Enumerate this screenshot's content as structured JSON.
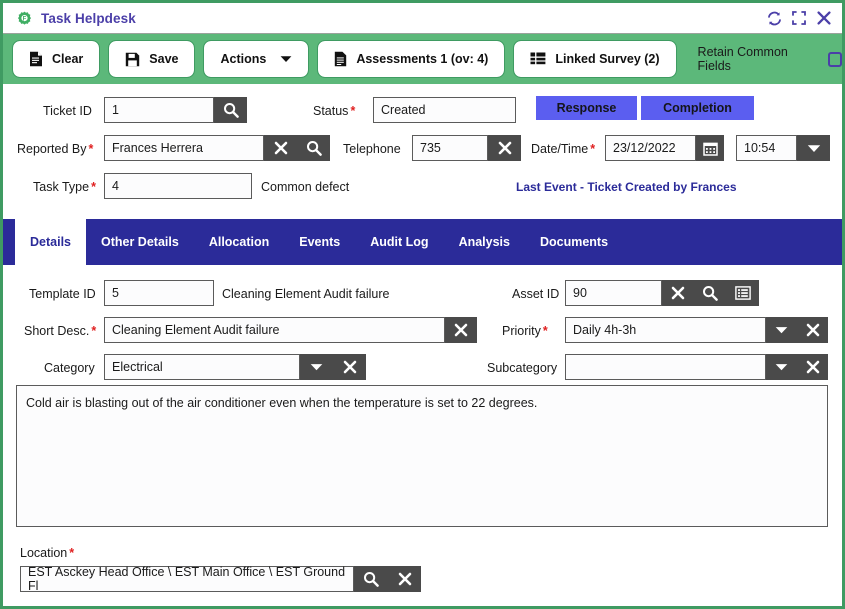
{
  "window": {
    "title": "Task Helpdesk",
    "icon": "gear-icon",
    "controls": [
      {
        "name": "refresh-icon",
        "label": "Refresh"
      },
      {
        "name": "maximize-icon",
        "label": "Maximize"
      },
      {
        "name": "close-icon",
        "label": "Close"
      }
    ],
    "accent_green": "#5cb87a",
    "accent_indigo": "#2b2b99",
    "accent_blue": "#5b5ef0"
  },
  "toolbar": {
    "buttons": [
      {
        "label": "Clear",
        "icon": "document-icon"
      },
      {
        "label": "Save",
        "icon": "floppy-disk-icon"
      },
      {
        "label": "Actions",
        "icon": "",
        "caret": true
      },
      {
        "label": "Assessments 1 (ov: 4)",
        "icon": "document-lines-icon"
      },
      {
        "label": "Linked Survey (2)",
        "icon": "list-grid-icon"
      }
    ],
    "retain_label": "Retain Common Fields",
    "retain_checked": false
  },
  "header": {
    "ticket_id": {
      "label": "Ticket ID",
      "value": "1",
      "required": false
    },
    "status": {
      "label": "Status",
      "value": "Created",
      "required": true
    },
    "reported_by": {
      "label": "Reported By",
      "value": "Frances Herrera",
      "required": true
    },
    "telephone": {
      "label": "Telephone",
      "value": "735",
      "required": false
    },
    "date_time": {
      "label": "Date/Time",
      "date": "23/12/2022",
      "time": "10:54",
      "required": true
    },
    "task_type": {
      "label": "Task Type",
      "value": "4",
      "required": true,
      "hint": "Common defect"
    },
    "response_button": "Response",
    "completion_button": "Completion",
    "last_event": "Last Event -  Ticket Created by Frances"
  },
  "tabs": [
    {
      "label": "Details",
      "active": true
    },
    {
      "label": "Other Details",
      "active": false
    },
    {
      "label": "Allocation",
      "active": false
    },
    {
      "label": "Events",
      "active": false
    },
    {
      "label": "Audit Log",
      "active": false
    },
    {
      "label": "Analysis",
      "active": false
    },
    {
      "label": "Documents",
      "active": false
    }
  ],
  "details": {
    "template_id": {
      "label": "Template ID",
      "value": "5",
      "hint": "Cleaning Element Audit failure"
    },
    "asset_id": {
      "label": "Asset ID",
      "value": "90"
    },
    "short_desc": {
      "label": "Short Desc.",
      "value": "Cleaning  Element Audit  failure",
      "required": true
    },
    "priority": {
      "label": "Priority",
      "value": "Daily 4h-3h",
      "required": true
    },
    "category": {
      "label": "Category",
      "value": "Electrical"
    },
    "subcategory": {
      "label": "Subcategory",
      "value": ""
    },
    "description": "Cold air is blasting out of the air conditioner even when the temperature is set to 22 degrees.",
    "location": {
      "label": "Location",
      "value": "EST Asckey Head Office \\ EST Main Office \\ EST Ground Fl",
      "required": true
    }
  }
}
